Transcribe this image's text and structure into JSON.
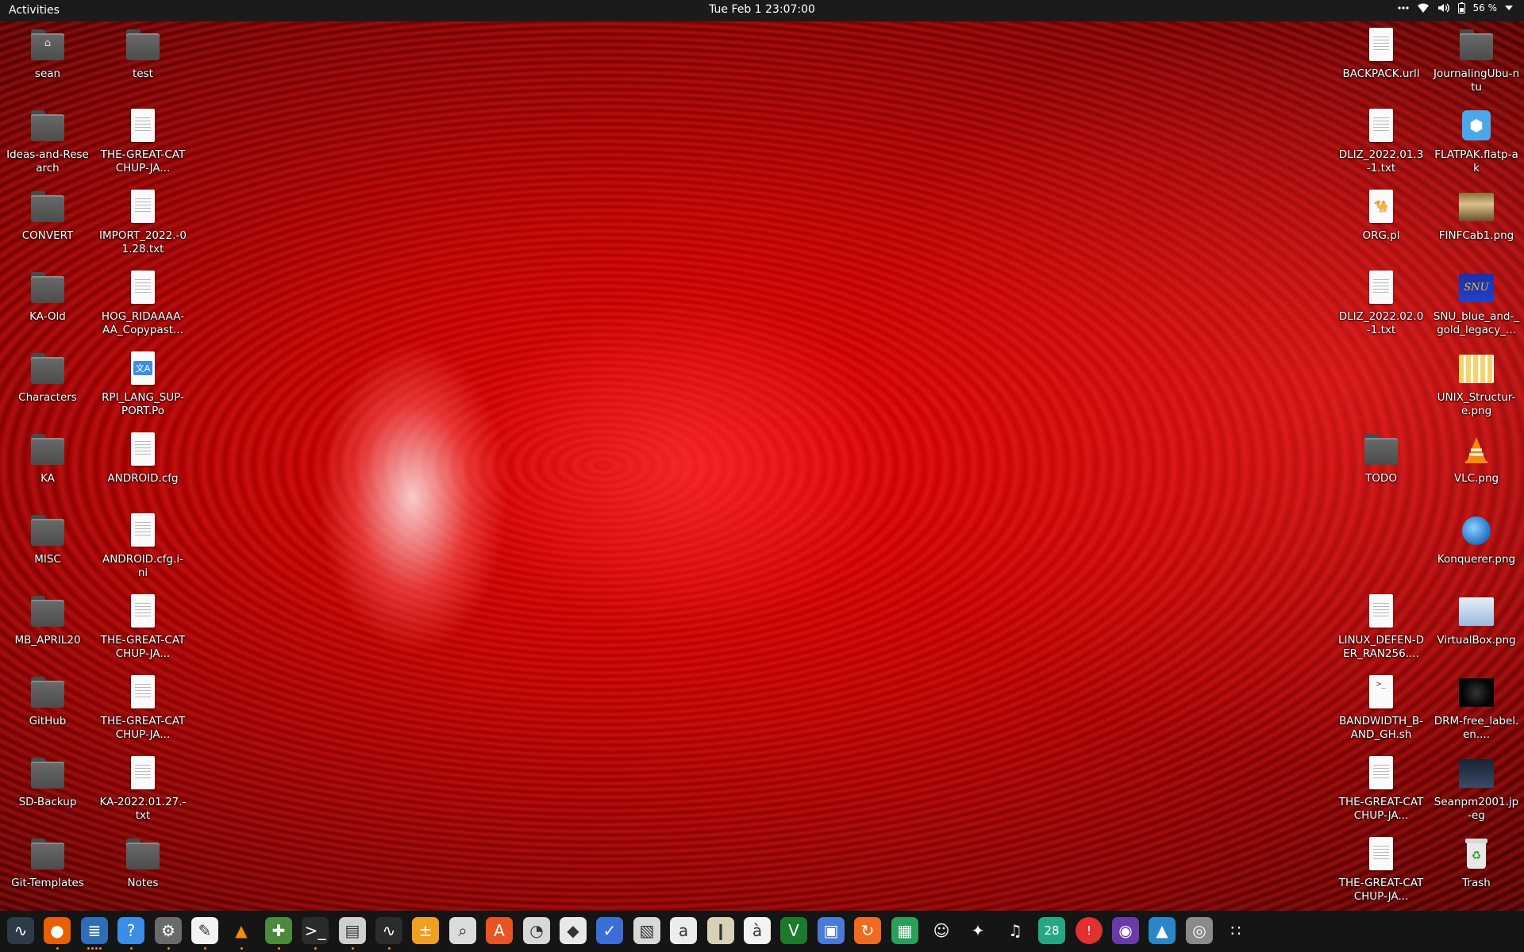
{
  "topbar": {
    "activities": "Activities",
    "clock": "Tue Feb 1  23:07:00",
    "battery_percent": "56 %"
  },
  "desktop": {
    "left_icons": [
      {
        "label": "sean",
        "type": "home-folder"
      },
      {
        "label": "test",
        "type": "folder"
      },
      {
        "label": "Ideas-and-Research",
        "type": "folder"
      },
      {
        "label": "THE-GREAT-CATCHUP-JA...",
        "type": "text-file"
      },
      {
        "label": "CONVERT",
        "type": "folder"
      },
      {
        "label": "IMPORT_2022.-01.28.txt",
        "type": "text-file"
      },
      {
        "label": "KA-Old",
        "type": "folder"
      },
      {
        "label": "HOG_RIDAAAA-AA_Copypast...",
        "type": "text-file"
      },
      {
        "label": "Characters",
        "type": "folder"
      },
      {
        "label": "RPI_LANG_SUP-PORT.Po",
        "type": "translation-file"
      },
      {
        "label": "KA",
        "type": "folder"
      },
      {
        "label": "ANDROID.cfg",
        "type": "text-file"
      },
      {
        "label": "MISC",
        "type": "folder"
      },
      {
        "label": "ANDROID.cfg.i-ni",
        "type": "text-file"
      },
      {
        "label": "MB_APRIL20",
        "type": "folder"
      },
      {
        "label": "THE-GREAT-CATCHUP-JA...",
        "type": "text-file"
      },
      {
        "label": "GitHub",
        "type": "folder"
      },
      {
        "label": "THE-GREAT-CATCHUP-JA...",
        "type": "text-file"
      },
      {
        "label": "SD-Backup",
        "type": "folder"
      },
      {
        "label": "KA-2022.01.27.-txt",
        "type": "text-file"
      },
      {
        "label": "Git-Templates",
        "type": "folder"
      },
      {
        "label": "Notes",
        "type": "folder"
      }
    ],
    "right_icons": [
      {
        "label": "BACKPACK.urll",
        "type": "text-file"
      },
      {
        "label": "JournalingUbu-ntu",
        "type": "folder"
      },
      {
        "label": "DLIZ_2022.01.3-1.txt",
        "type": "text-file"
      },
      {
        "label": "FLATPAK.flatp-ak",
        "type": "flatpak-package"
      },
      {
        "label": "ORG.pl",
        "type": "perl-script"
      },
      {
        "label": "FINFCab1.png",
        "type": "image"
      },
      {
        "label": "DLIZ_2022.02.0-1.txt",
        "type": "text-file"
      },
      {
        "label": "SNU_blue_and-_gold_legacy_...",
        "type": "image"
      },
      {
        "label": "UNIX_Structur-e.png",
        "type": "image"
      },
      {
        "label": "TODO",
        "type": "folder"
      },
      {
        "label": "VLC.png",
        "type": "image"
      },
      {
        "label": "Konquerer.png",
        "type": "image"
      },
      {
        "label": "LINUX_DEFEN-DER_RAN256....",
        "type": "text-file"
      },
      {
        "label": "VirtualBox.png",
        "type": "image"
      },
      {
        "label": "BANDWIDTH_B-AND_GH.sh",
        "type": "shell-script"
      },
      {
        "label": "DRM-free_label.en....",
        "type": "image"
      },
      {
        "label": "THE-GREAT-CATCHUP-JA...",
        "type": "text-file"
      },
      {
        "label": "Seanpm2001.jp-eg",
        "type": "image"
      },
      {
        "label": "THE-GREAT-CATCHUP-JA...",
        "type": "text-file"
      },
      {
        "label": "Trash",
        "type": "trash"
      }
    ]
  },
  "dock": {
    "apps": [
      {
        "name": "system-monitor-icon"
      },
      {
        "name": "firefox-icon"
      },
      {
        "name": "document-viewer-icon"
      },
      {
        "name": "help-icon"
      },
      {
        "name": "settings-icon"
      },
      {
        "name": "text-editor-icon"
      },
      {
        "name": "vlc-icon"
      },
      {
        "name": "puzzle-icon"
      },
      {
        "name": "terminal-icon"
      },
      {
        "name": "files-icon"
      },
      {
        "name": "waveform-icon"
      },
      {
        "name": "calculator-icon"
      },
      {
        "name": "image-viewer-icon"
      },
      {
        "name": "software-store-icon"
      },
      {
        "name": "disk-usage-icon"
      },
      {
        "name": "inkscape-icon"
      },
      {
        "name": "todo-icon"
      },
      {
        "name": "dictionary-icon"
      },
      {
        "name": "font-viewer-icon"
      },
      {
        "name": "archive-manager-icon"
      },
      {
        "name": "character-map-icon"
      },
      {
        "name": "vim-icon"
      },
      {
        "name": "screenshot-icon"
      },
      {
        "name": "updates-icon"
      },
      {
        "name": "spreadsheet-icon"
      },
      {
        "name": "game-icon"
      },
      {
        "name": "gimp-icon"
      },
      {
        "name": "music-icon"
      },
      {
        "name": "calendar-icon",
        "text": "28"
      },
      {
        "name": "error-report-icon",
        "text": "!"
      },
      {
        "name": "webcam-icon"
      },
      {
        "name": "photo-app-icon"
      },
      {
        "name": "installer-icon"
      },
      {
        "name": "app-grid-icon"
      }
    ]
  },
  "colors": {
    "accent": "#e95420",
    "panel": "#1b1b1b",
    "running_dot": "#f08a24"
  }
}
